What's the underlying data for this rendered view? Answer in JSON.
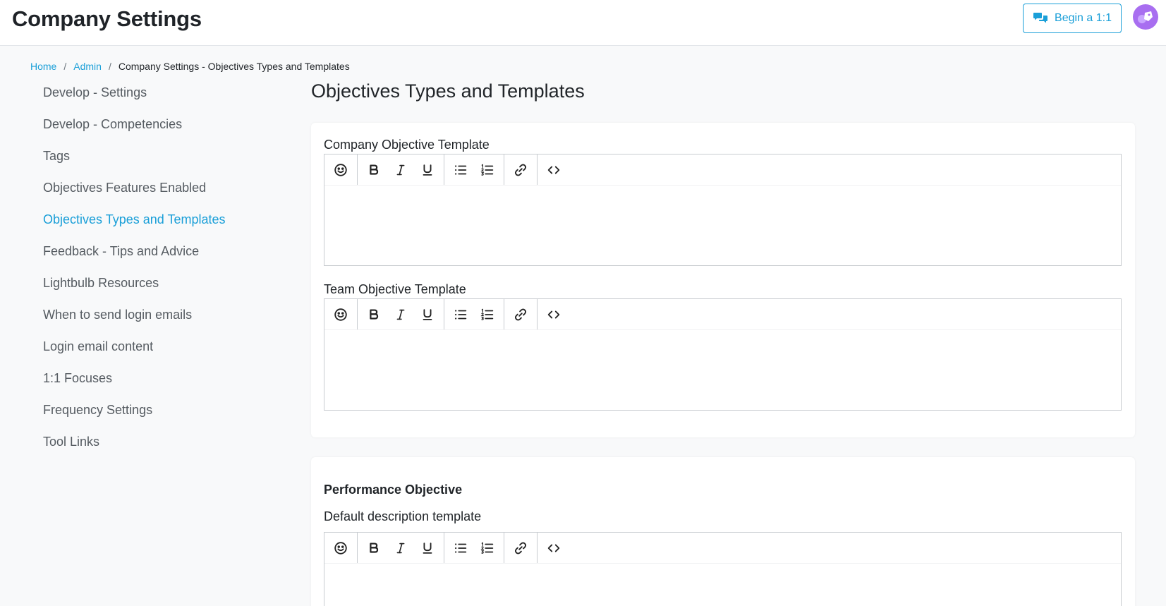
{
  "header": {
    "title": "Company Settings",
    "begin_button": "Begin a 1:1"
  },
  "breadcrumb": {
    "home": "Home",
    "admin": "Admin",
    "current": "Company Settings - Objectives Types and Templates",
    "separator": "/"
  },
  "sidebar": {
    "items": [
      {
        "label": "Develop - Settings"
      },
      {
        "label": "Develop - Competencies"
      },
      {
        "label": "Tags"
      },
      {
        "label": "Objectives Features Enabled"
      },
      {
        "label": "Objectives Types and Templates",
        "active": true
      },
      {
        "label": "Feedback - Tips and Advice"
      },
      {
        "label": "Lightbulb Resources"
      },
      {
        "label": "When to send login emails"
      },
      {
        "label": "Login email content"
      },
      {
        "label": "1:1 Focuses"
      },
      {
        "label": "Frequency Settings"
      },
      {
        "label": "Tool Links"
      }
    ]
  },
  "main": {
    "title": "Objectives Types and Templates",
    "company_template_label": "Company Objective Template",
    "team_template_label": "Team Objective Template",
    "performance_section": "Performance Objective",
    "default_description_label": "Default description template"
  },
  "toolbar_icons": [
    "emoji-icon",
    "bold-icon",
    "italic-icon",
    "underline-icon",
    "bullet-list-icon",
    "numbered-list-icon",
    "link-icon",
    "code-view-icon"
  ],
  "colors": {
    "accent": "#1a9fd8",
    "background": "#f8f9fa",
    "avatar": "#a86ef0"
  }
}
